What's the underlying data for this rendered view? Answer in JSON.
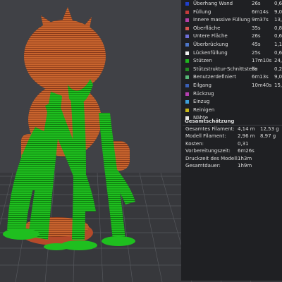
{
  "legend": {
    "items": [
      {
        "label": "Überhang Wand",
        "time": "26s",
        "pct": "0,65",
        "color": "#1f3fcc"
      },
      {
        "label": "Füllung",
        "time": "6m14s",
        "pct": "9,05",
        "color": "#c23b3b"
      },
      {
        "label": "Innere massive Füllung",
        "time": "9m37s",
        "pct": "13,9",
        "color": "#b43fa8"
      },
      {
        "label": "Oberfläche",
        "time": "35s",
        "pct": "0,89",
        "color": "#d9534f"
      },
      {
        "label": "Untere Fläche",
        "time": "26s",
        "pct": "0,65",
        "color": "#6e6ed6"
      },
      {
        "label": "Überbrückung",
        "time": "45s",
        "pct": "1,1",
        "color": "#4d76c8"
      },
      {
        "label": "Lückenfüllung",
        "time": "25s",
        "pct": "0,61",
        "color": "#f2f2f2"
      },
      {
        "label": "Stützen",
        "time": "17m10s",
        "pct": "24,8",
        "color": "#1fb51f"
      },
      {
        "label": "Stützstruktur-Schnittstelle",
        "time": "8s",
        "pct": "0,2",
        "color": "#228b22"
      },
      {
        "label": "Benutzerdefiniert",
        "time": "6m13s",
        "pct": "9,05",
        "color": "#58b878"
      },
      {
        "label": "Eilgang",
        "time": "10m40s",
        "pct": "15,4",
        "color": "#3a5fb5"
      },
      {
        "label": "Rückzug",
        "time": "",
        "pct": "",
        "color": "#b43fb0"
      },
      {
        "label": "Einzug",
        "time": "",
        "pct": "",
        "color": "#3e9fd8"
      },
      {
        "label": "Reinigen",
        "time": "",
        "pct": "",
        "color": "#c8b81a"
      },
      {
        "label": "Nähte",
        "time": "",
        "pct": "",
        "color": "#e8e8e8"
      }
    ]
  },
  "summary": {
    "title": "Gesamtschätzung",
    "rows": [
      {
        "label": "Gesamtes Filament:",
        "v1": "4,14 m",
        "v2": "12,53 g"
      },
      {
        "label": "Modell Filament:",
        "v1": "2,96 m",
        "v2": "8,97 g"
      },
      {
        "label": "Kosten:",
        "v1": "0,31",
        "v2": ""
      },
      {
        "label": "Vorbereitungszeit:",
        "v1": "6m26s",
        "v2": ""
      },
      {
        "label": "Druckzeit des Modell:",
        "v1": "1h3m",
        "v2": ""
      },
      {
        "label": "Gesamtdauer:",
        "v1": "1h9m",
        "v2": ""
      }
    ]
  },
  "colors": {
    "bed": "#3b3c40",
    "grid_line": "#55575c",
    "model": "#c9652e",
    "model_dark": "#8a3a1a",
    "support": "#1fb51f",
    "support_dark": "#0f7d0f",
    "panel_bg": "#1f2023"
  }
}
